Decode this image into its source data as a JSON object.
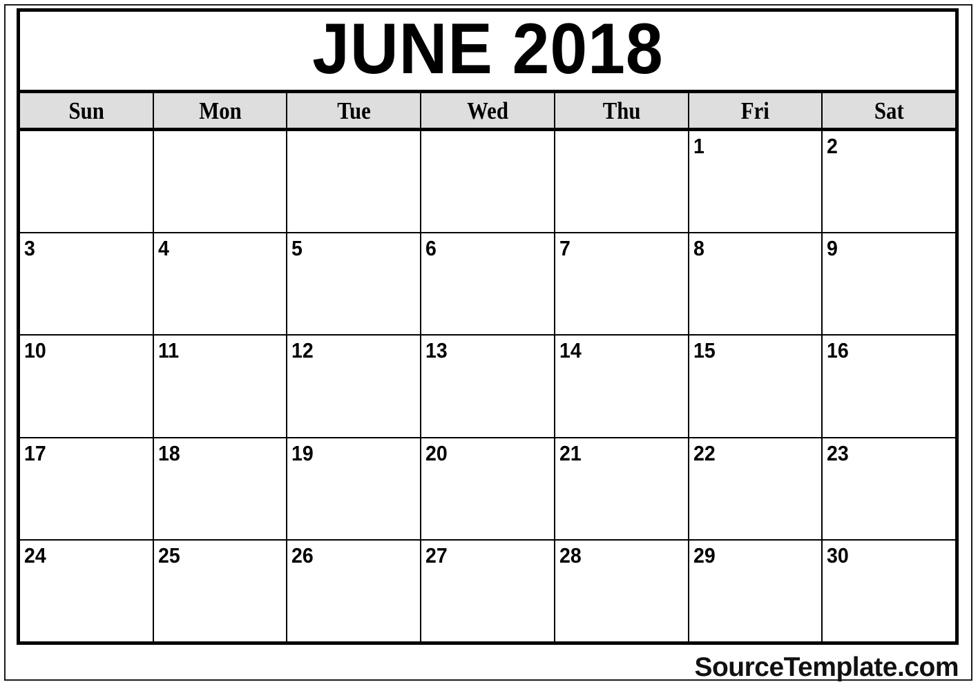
{
  "document": {
    "title": "JUNE 2018",
    "month": "JUNE",
    "year": "2018"
  },
  "weekdays": [
    {
      "label": "Sun"
    },
    {
      "label": "Mon"
    },
    {
      "label": "Tue"
    },
    {
      "label": "Wed"
    },
    {
      "label": "Thu"
    },
    {
      "label": "Fri"
    },
    {
      "label": "Sat"
    }
  ],
  "weeks": [
    {
      "days": [
        {
          "number": "",
          "empty": true
        },
        {
          "number": "",
          "empty": true
        },
        {
          "number": "",
          "empty": true
        },
        {
          "number": "",
          "empty": true
        },
        {
          "number": "",
          "empty": true
        },
        {
          "number": "1",
          "empty": false
        },
        {
          "number": "2",
          "empty": false
        }
      ]
    },
    {
      "days": [
        {
          "number": "3",
          "empty": false
        },
        {
          "number": "4",
          "empty": false
        },
        {
          "number": "5",
          "empty": false
        },
        {
          "number": "6",
          "empty": false
        },
        {
          "number": "7",
          "empty": false
        },
        {
          "number": "8",
          "empty": false
        },
        {
          "number": "9",
          "empty": false
        }
      ]
    },
    {
      "days": [
        {
          "number": "10",
          "empty": false
        },
        {
          "number": "11",
          "empty": false
        },
        {
          "number": "12",
          "empty": false
        },
        {
          "number": "13",
          "empty": false
        },
        {
          "number": "14",
          "empty": false
        },
        {
          "number": "15",
          "empty": false
        },
        {
          "number": "16",
          "empty": false
        }
      ]
    },
    {
      "days": [
        {
          "number": "17",
          "empty": false
        },
        {
          "number": "18",
          "empty": false
        },
        {
          "number": "19",
          "empty": false
        },
        {
          "number": "20",
          "empty": false
        },
        {
          "number": "21",
          "empty": false
        },
        {
          "number": "22",
          "empty": false
        },
        {
          "number": "23",
          "empty": false
        }
      ]
    },
    {
      "days": [
        {
          "number": "24",
          "empty": false
        },
        {
          "number": "25",
          "empty": false
        },
        {
          "number": "26",
          "empty": false
        },
        {
          "number": "27",
          "empty": false
        },
        {
          "number": "28",
          "empty": false
        },
        {
          "number": "29",
          "empty": false
        },
        {
          "number": "30",
          "empty": false
        }
      ]
    }
  ],
  "watermark": {
    "text": "SourceTemplate.com"
  },
  "colors": {
    "header_background": "#dedede",
    "border": "#000000",
    "text": "#000000",
    "page_background": "#ffffff"
  }
}
